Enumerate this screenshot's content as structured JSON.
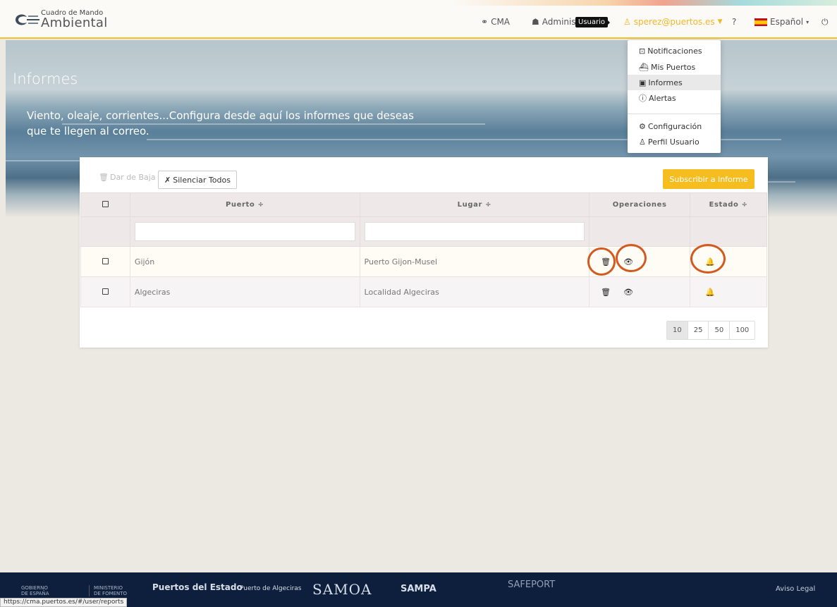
{
  "header": {
    "logo_small": "Cuadro de Mando",
    "logo_big": "Ambiental",
    "nav_cma": "CMA",
    "nav_admin": "Administ",
    "tooltip": "Usuario",
    "user_email": "sperez@puertos.es",
    "help": "?",
    "language": "Español",
    "accent_color": "#f1c22a"
  },
  "user_menu": {
    "items": [
      {
        "label": "Notificaciones",
        "icon": "notification-icon"
      },
      {
        "label": "Mis Puertos",
        "icon": "ship-icon"
      },
      {
        "label": "Informes",
        "icon": "report-icon",
        "active": true
      },
      {
        "label": "Alertas",
        "icon": "alert-icon"
      },
      {
        "label": "Configuración",
        "icon": "gear-icon"
      },
      {
        "label": "Perfil Usuario",
        "icon": "user-icon"
      }
    ]
  },
  "hero": {
    "title": "Informes",
    "subtitle": "Viento, oleaje, corrientes...Configura desde aquí los informes que deseas que te llegen al correo."
  },
  "toolbar": {
    "unsubscribe": "Dar de Baja",
    "mute_all": "Silenciar Todos",
    "subscribe": "Subscribir a Informe",
    "subscribe_color": "#f5bd1f"
  },
  "table": {
    "columns": {
      "puerto": "Puerto ÷",
      "lugar": "Lugar ÷",
      "operaciones": "Operaciones",
      "estado": "Estado ÷"
    },
    "rows": [
      {
        "puerto": "Gijón",
        "lugar": "Puerto Gijon-Musel"
      },
      {
        "puerto": "Algeciras",
        "lugar": "Localidad Algeciras"
      }
    ]
  },
  "pagination": [
    "10",
    "25",
    "50",
    "100"
  ],
  "footer": {
    "gobierno": "GOBIERNO\nDE ESPAÑA",
    "ministerio": "MINISTERIO\nDE FOMENTO",
    "puertos_estado": "Puertos del Estado",
    "puerto_algeciras": "Puerto de Algeciras",
    "samoa": "SAMOA",
    "sampa": "SAMPA",
    "safeport": "SAFEPORT",
    "aviso_legal": "Aviso Legal"
  },
  "status_url": "https://cma.puertos.es/#/user/reports"
}
